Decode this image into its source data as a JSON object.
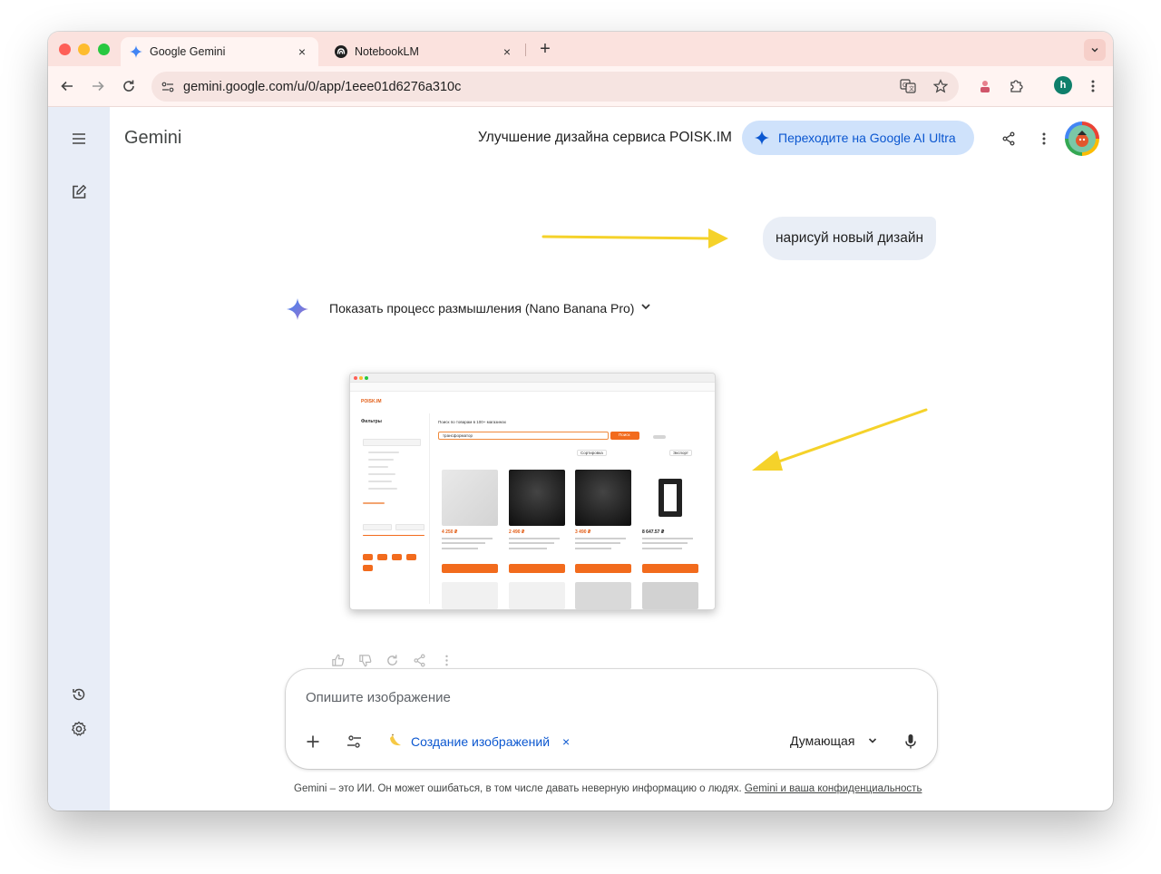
{
  "browser": {
    "tabs": [
      {
        "title": "Google Gemini",
        "active": true
      },
      {
        "title": "NotebookLM",
        "active": false
      }
    ],
    "close_glyph": "×",
    "newtab_glyph": "+",
    "url": "gemini.google.com/u/0/app/1eee01d6276a310c",
    "profile_initial": "h"
  },
  "app": {
    "brand": "Gemini",
    "chat_title": "Улучшение дизайна сервиса POISK.IM",
    "upgrade_label": "Переходите на Google AI Ultra"
  },
  "conversation": {
    "user_message": "нарисуй новый дизайн",
    "thinking_label": "Показать процесс размышления (Nano Banana Pro)"
  },
  "generated_image": {
    "logo": "POISK.IM",
    "filters_heading": "Фильтры",
    "search_heading": "Поиск по товарам в 100+ магазинах",
    "search_query": "трансформатор",
    "search_button": "Поиск",
    "sort_label": "Сортировка",
    "export_label": "Экспорт",
    "prices": [
      "4 250 ₽",
      "2 490 ₽",
      "3 490 ₽",
      "8 647.57 ₽"
    ]
  },
  "composer": {
    "placeholder": "Опишите изображение",
    "tool_chip": "Создание изображений",
    "chip_close": "×",
    "mode": "Думающая"
  },
  "footer": {
    "disclaimer": "Gemini – это ИИ. Он может ошибаться, в том числе давать неверную информацию о людях. ",
    "privacy_link": "Gemini и ваша конфиденциальность"
  },
  "colors": {
    "accent": "#0b57d0",
    "tab_strip": "#fbe2de",
    "sidebar": "#e8edf7",
    "annotation_arrow": "#f5d22a"
  }
}
